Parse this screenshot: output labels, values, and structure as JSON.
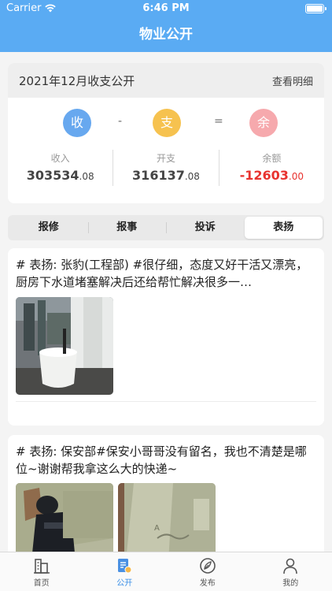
{
  "status_bar": {
    "carrier": "Carrier",
    "time": "6:46 PM"
  },
  "nav": {
    "title": "物业公开"
  },
  "summary": {
    "title": "2021年12月收支公开",
    "detail_link": "查看明细",
    "circles": {
      "income": "收",
      "minus": "-",
      "expense": "支",
      "equals": "=",
      "balance": "余"
    },
    "colors": {
      "income": "#67a8ef",
      "expense": "#f6c24f",
      "balance": "#f6a9ad",
      "negative": "#e8332f"
    },
    "income": {
      "label": "收入",
      "int": "303534",
      "dec": ".08"
    },
    "expense": {
      "label": "开支",
      "int": "316137",
      "dec": ".08"
    },
    "balance": {
      "label": "余额",
      "int": "-12603",
      "dec": ".00"
    }
  },
  "tabs": [
    {
      "label": "报修",
      "active": false
    },
    {
      "label": "报事",
      "active": false
    },
    {
      "label": "投诉",
      "active": false
    },
    {
      "label": "表扬",
      "active": true
    }
  ],
  "posts": [
    {
      "text": "# 表扬: 张豹(工程部) #很仔细，态度又好干活又漂亮，厨房下水道堵塞解决后还给帮忙解决很多一…",
      "photo_count": 1
    },
    {
      "text": "# 表扬: 保安部#保安小哥哥没有留名，我也不清楚是哪位~谢谢帮我拿这么大的快递~",
      "photo_count": 2
    }
  ],
  "tabbar": [
    {
      "label": "首页",
      "icon": "building-icon",
      "active": false
    },
    {
      "label": "公开",
      "icon": "document-icon",
      "active": true
    },
    {
      "label": "发布",
      "icon": "feather-icon",
      "active": false
    },
    {
      "label": "我的",
      "icon": "user-icon",
      "active": false
    }
  ]
}
